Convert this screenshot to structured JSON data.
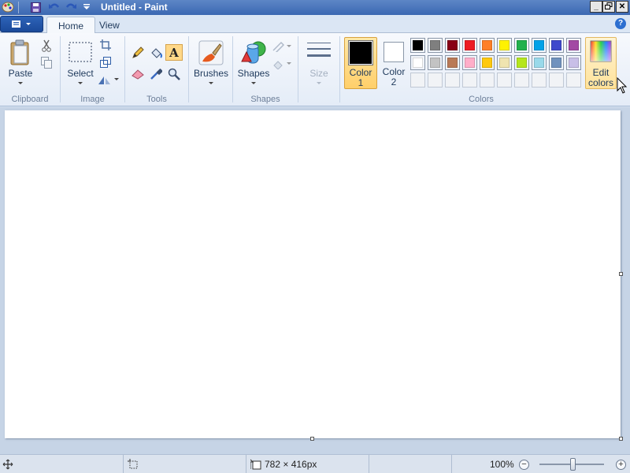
{
  "window": {
    "title": "Untitled - Paint",
    "minimize_icon": "minimize-icon",
    "restore_icon": "restore-icon",
    "close_icon": "close-icon"
  },
  "quick_access": [
    "paint-app-icon",
    "save-icon",
    "undo-icon",
    "redo-icon",
    "customize-dropdown-icon"
  ],
  "tabs": {
    "home": "Home",
    "view": "View"
  },
  "help_label": "?",
  "ribbon": {
    "clipboard": {
      "group": "Clipboard",
      "paste": "Paste"
    },
    "image": {
      "group": "Image",
      "select": "Select"
    },
    "tools": {
      "group": "Tools",
      "text_glyph": "A"
    },
    "brushes": {
      "label": "Brushes"
    },
    "shapes": {
      "group": "Shapes",
      "label": "Shapes"
    },
    "size": {
      "label": "Size"
    },
    "colors": {
      "group": "Colors",
      "color1_line1": "Color",
      "color1_line2": "1",
      "color2_line1": "Color",
      "color2_line2": "2",
      "edit_line1": "Edit",
      "edit_line2": "colors",
      "color1_value": "#000000",
      "color2_value": "#ffffff",
      "palette_row1": [
        "#000000",
        "#7f7f7f",
        "#880015",
        "#ed1c24",
        "#ff7f27",
        "#fff200",
        "#22b14c",
        "#00a2e8",
        "#3f48cc",
        "#a349a4"
      ],
      "palette_row2": [
        "#ffffff",
        "#c3c3c3",
        "#b97a57",
        "#ffaec9",
        "#ffc90e",
        "#efe4b0",
        "#b5e61d",
        "#99d9ea",
        "#7092be",
        "#c8bfe7"
      ]
    }
  },
  "status": {
    "canvas_size": "782 × 416px",
    "zoom": "100%",
    "zoom_minus": "−",
    "zoom_plus": "+"
  }
}
